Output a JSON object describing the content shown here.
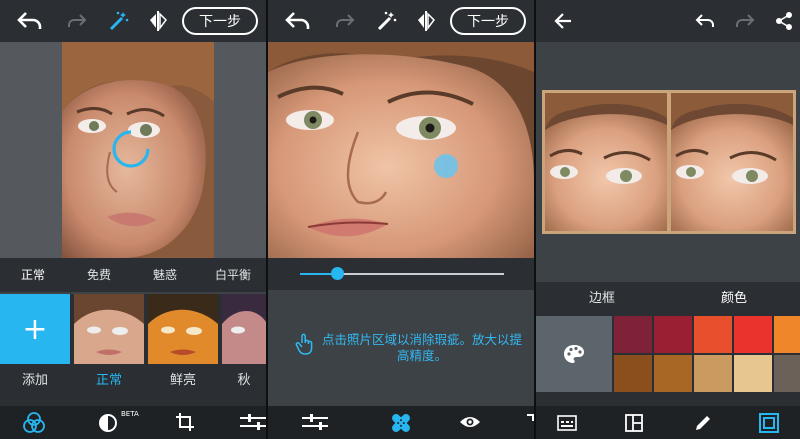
{
  "colors": {
    "accent": "#27b6f0",
    "panel_bg": "#3d4247",
    "bar_bg": "#2b2f33",
    "bottom_bg": "#1f2225"
  },
  "panel1": {
    "toolbar": {
      "undo_icon": "undo-icon",
      "redo_icon": "redo-icon",
      "magic_icon": "magic-wand-icon",
      "compare_icon": "compare-icon",
      "next_label": "下一步"
    },
    "filter_tabs": [
      "正常",
      "免费",
      "魅惑",
      "白平衡"
    ],
    "add_label": "+",
    "thumb_labels": [
      "添加",
      "正常",
      "鲜亮",
      "秋"
    ],
    "thumb_active_index": 1,
    "beta_label": "BETA",
    "bottom_icons": [
      "filters-icon",
      "looks-icon",
      "crop-icon",
      "adjust-icon"
    ]
  },
  "panel2": {
    "toolbar": {
      "undo_icon": "undo-icon",
      "redo_icon": "redo-icon",
      "magic_icon": "magic-wand-icon",
      "compare_icon": "compare-icon",
      "next_label": "下一步"
    },
    "slider_value": 0.18,
    "hint_text": "点击照片区域以消除瑕疵。放大以提高精度。",
    "hint_icon": "tap-hand-icon",
    "bottom_icons": [
      "adjust-icon",
      "heal-bandage-icon",
      "eye-icon",
      "expand-icon"
    ]
  },
  "panel3": {
    "toolbar": {
      "back_icon": "back-arrow-icon",
      "undo_icon": "undo-icon",
      "redo_icon": "redo-icon",
      "share_icon": "share-icon"
    },
    "tabs": [
      "边框",
      "颜色"
    ],
    "active_tab_index": 1,
    "palette_icon": "palette-icon",
    "swatches_row1": [
      "#7f2237",
      "#9b1f33",
      "#e8502d",
      "#e9332c",
      "#f0862a"
    ],
    "swatches_row2": [
      "#8a4f1c",
      "#a86724",
      "#cb9a60",
      "#e7c68f",
      "#6b6158"
    ],
    "bottom_icons": [
      "text-icon",
      "layout-icon",
      "pencil-icon",
      "frame-icon"
    ]
  }
}
